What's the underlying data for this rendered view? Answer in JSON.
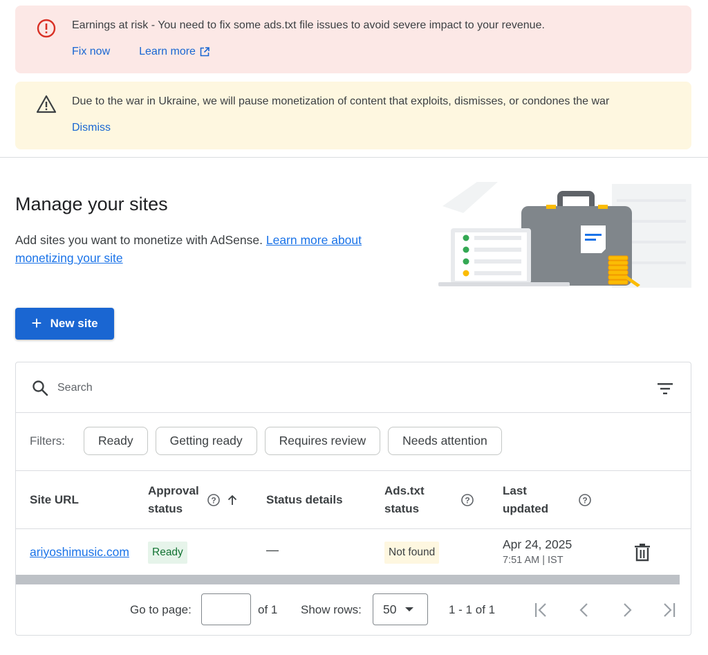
{
  "banners": {
    "error": {
      "icon": "error-icon",
      "message": "Earnings at risk - You need to fix some ads.txt file issues to avoid severe impact to your revenue.",
      "fix_label": "Fix now",
      "learn_label": "Learn more",
      "color": "#fce8e6"
    },
    "warning": {
      "icon": "warning-icon",
      "message": "Due to the war in Ukraine, we will pause monetization of content that exploits, dismisses, or condones the war",
      "dismiss_label": "Dismiss",
      "color": "#fef7e0"
    }
  },
  "header": {
    "title": "Manage your sites",
    "description": "Add sites you want to monetize with AdSense.",
    "link": "Learn more about monetizing your site"
  },
  "new_site_label": "New site",
  "search": {
    "placeholder": "Search"
  },
  "filters": {
    "label": "Filters:",
    "chips": [
      "Ready",
      "Getting ready",
      "Requires review",
      "Needs attention"
    ]
  },
  "table": {
    "columns": {
      "site_url": "Site URL",
      "approval_1": "Approval",
      "approval_2": "status",
      "status_details": "Status details",
      "ads_1": "Ads.txt",
      "ads_2": "status",
      "updated_1": "Last",
      "updated_2": "updated"
    },
    "rows": [
      {
        "site": "ariyoshimusic.com",
        "approval": "Ready",
        "status_details": "—",
        "ads_txt": "Not found",
        "updated_date": "Apr 24, 2025",
        "updated_time": "7:51 AM | IST"
      }
    ]
  },
  "pagination": {
    "go_to_page": "Go to page:",
    "of_pages": "of 1",
    "show_rows": "Show rows:",
    "rows_value": "50",
    "range": "1 - 1 of 1"
  },
  "colors": {
    "primary": "#1a66d2",
    "link": "#1a73e8",
    "ready_bg": "#e6f4ea",
    "ready_fg": "#137333",
    "not_found_bg": "#fef7e0"
  }
}
